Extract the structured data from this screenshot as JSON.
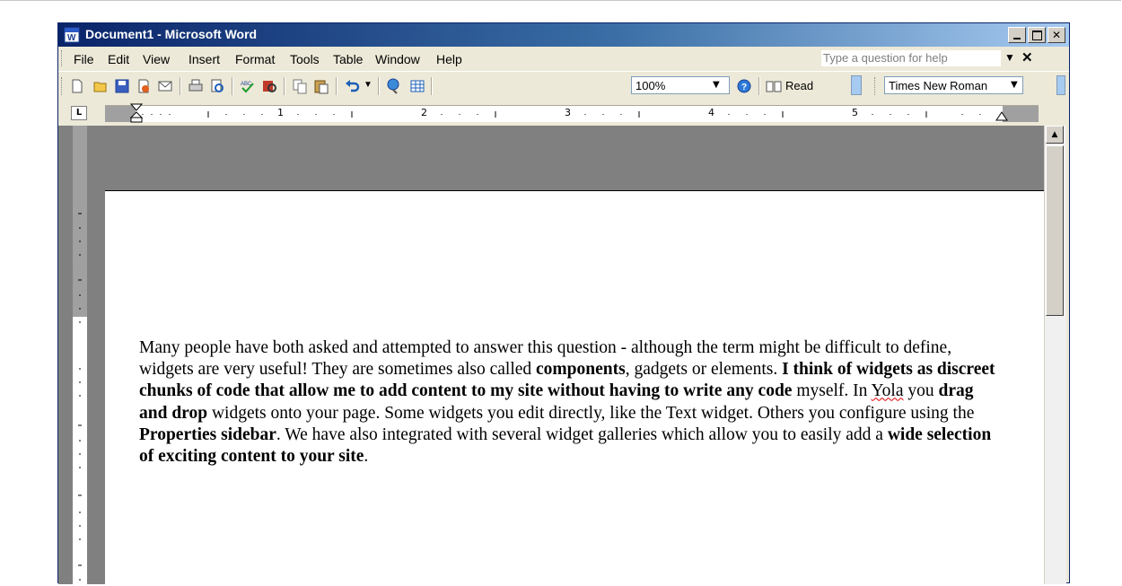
{
  "window": {
    "title": "Document1 - Microsoft Word"
  },
  "menu": {
    "items": [
      "File",
      "Edit",
      "View",
      "Insert",
      "Format",
      "Tools",
      "Table",
      "Window",
      "Help"
    ],
    "help_placeholder": "Type a question for help"
  },
  "toolbar": {
    "zoom": "100%",
    "read_label": "Read",
    "font": "Times New Roman"
  },
  "ruler": {
    "numbers": [
      "1",
      "2",
      "3",
      "4",
      "5"
    ]
  },
  "document": {
    "p1": "Many people have both asked and attempted to answer this question - although the term might be difficult to define, widgets are very useful! They are sometimes also called ",
    "b1": "components",
    "p2": ", gadgets or elements. ",
    "b2": "I think of widgets as discreet chunks of code that allow me to add content to my site without having to write any code",
    "p3": " myself. In ",
    "misspelled": "Yola",
    "p4": " you ",
    "b3": "drag and drop",
    "p5": " widgets onto your page. Some widgets you edit directly, like the Text widget. Others you configure using the ",
    "b4": "Properties sidebar",
    "p6": ". We have also integrated with several widget galleries which allow you to easily add a ",
    "b5": "wide selection of exciting content to your site",
    "p7": "."
  }
}
